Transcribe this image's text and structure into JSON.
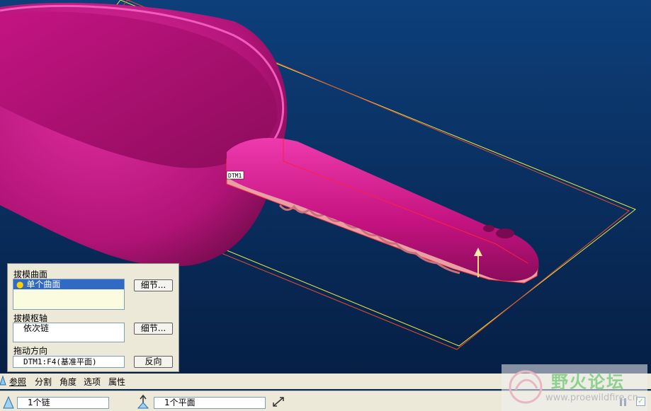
{
  "viewport": {
    "model_label": "DTM1",
    "background_top": "#0d3f7a",
    "background_bottom": "#061f45",
    "model_color": "#d21a8c",
    "draft_surface_color": "#e9a0a5",
    "plane_outline_colors": [
      "#e8e84a",
      "#e0502a"
    ]
  },
  "panel": {
    "draft_surfaces": {
      "label": "拔模曲面",
      "items": [
        "单个曲面"
      ],
      "detail_button": "细节..."
    },
    "draft_hinges": {
      "label": "拔模枢轴",
      "items": [
        "依次链"
      ],
      "detail_button": "细节..."
    },
    "pull_direction": {
      "label": "拖动方向",
      "value": "DTM1:F4(基准平面)",
      "flip_button": "反向"
    }
  },
  "tabs": [
    "参照",
    "分割",
    "角度",
    "选项",
    "属性"
  ],
  "dashboard": {
    "surfaces_field": "1个链",
    "hinge_field": "1个平面"
  },
  "watermark": {
    "text": "野火论坛",
    "url": "www.proewildfire.cn"
  }
}
